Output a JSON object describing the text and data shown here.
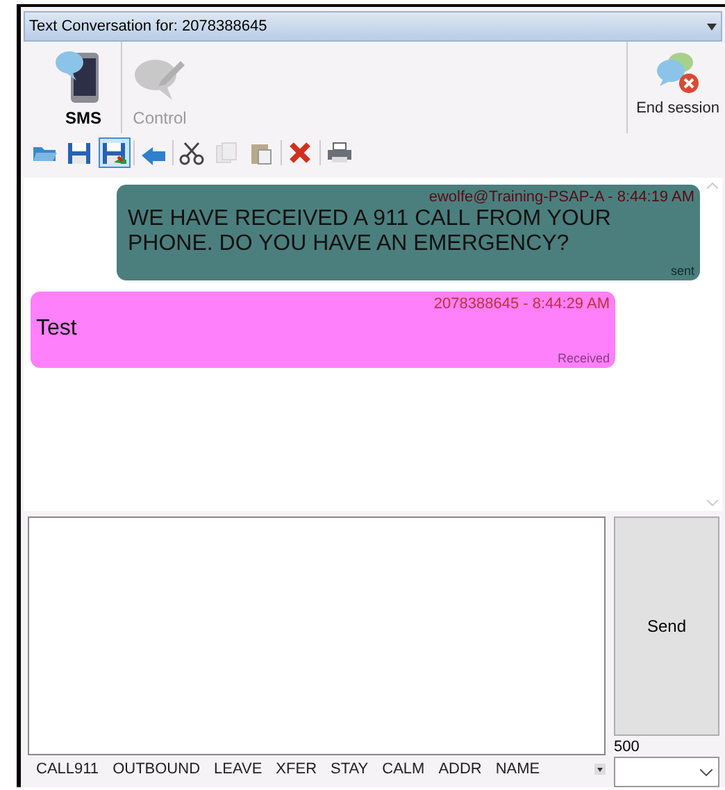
{
  "window": {
    "title": "Text Conversation for: 2078388645"
  },
  "modes": [
    {
      "kind": "sms",
      "label": "SMS",
      "selected": true,
      "disabled": false
    },
    {
      "kind": "control",
      "label": "Control",
      "selected": false,
      "disabled": true
    }
  ],
  "end_session": {
    "label": "End session"
  },
  "toolbar": [
    {
      "kind": "open",
      "selected": false,
      "disabled": false
    },
    {
      "kind": "save",
      "selected": false,
      "disabled": false
    },
    {
      "kind": "save-as",
      "selected": true,
      "disabled": false
    },
    {
      "kind": "reply",
      "selected": false,
      "disabled": false
    },
    {
      "kind": "cut",
      "selected": false,
      "disabled": false
    },
    {
      "kind": "copy",
      "selected": false,
      "disabled": true
    },
    {
      "kind": "paste",
      "selected": false,
      "disabled": false
    },
    {
      "kind": "delete",
      "selected": false,
      "disabled": false
    },
    {
      "kind": "print",
      "selected": false,
      "disabled": false
    }
  ],
  "messages": [
    {
      "kind": "sent",
      "header": "ewolfe@Training-PSAP-A - 8:44:19 AM",
      "text": "WE HAVE RECEIVED A 911 CALL FROM YOUR PHONE. DO YOU HAVE AN EMERGENCY?",
      "status": "sent"
    },
    {
      "kind": "received",
      "header": "2078388645 - 8:44:29 AM",
      "text": "Test",
      "status": "Received"
    }
  ],
  "send_button": "Send",
  "char_count": "500",
  "quick_replies": [
    "CALL911",
    "OUTBOUND",
    "LEAVE",
    "XFER",
    "STAY",
    "CALM",
    "ADDR",
    "NAME"
  ]
}
